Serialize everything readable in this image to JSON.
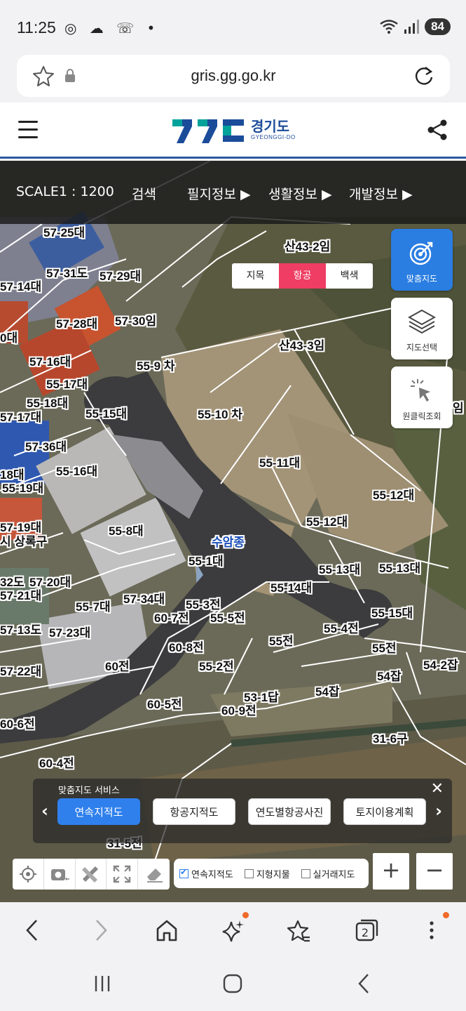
{
  "status": {
    "time": "11:25",
    "battery": "84",
    "notif_icons": "◎ ☁ ☏ •"
  },
  "browser": {
    "url": "gris.gg.go.kr"
  },
  "site": {
    "logo_text": "경기도",
    "logo_sub": "GYEONGGI-DO"
  },
  "topnav": {
    "scale": "SCALE1 : 1200",
    "search": "검색",
    "parcel": "필지정보 ▶",
    "life": "생활정보 ▶",
    "dev": "개발정보 ▶"
  },
  "map_mode": {
    "items": [
      "지목",
      "항공",
      "백색"
    ],
    "selected": "항공"
  },
  "side_buttons": {
    "custom": "맞춤지도",
    "select": "지도선택",
    "oneclick": "원클릭조회"
  },
  "service": {
    "title": "맞춤지도 서비스",
    "close": "✕",
    "chips": [
      "연속지적도",
      "항공지적도",
      "연도별항공사진",
      "토지이용계획"
    ],
    "active": "연속지적도"
  },
  "layers": {
    "items": [
      "연속지적도",
      "지형지물",
      "실거래지도"
    ],
    "checked": "연속지적도"
  },
  "zoom": {
    "plus": "+",
    "minus": "−"
  },
  "parcels": [
    "57-25대",
    "산43-2임",
    "57-31도",
    "57-29대",
    "57-14대",
    "57-28대",
    "57-30임",
    "0대",
    "산43-3임",
    "57-16대",
    "55-9 차",
    "55-17대",
    "55-18대",
    "55-15대",
    "57-17대",
    "55-10 차",
    "57-36대",
    "55-11대",
    "55-16대",
    "18대",
    "55-19대",
    "55-12대",
    "55-12대",
    "55-8대",
    "57-19대",
    "수암종",
    "시 상록구",
    "55-1대",
    "55-13대",
    "55-13대",
    "32도",
    "57-20대",
    "57-21대",
    "55-14대",
    "57-34대",
    "55-7대",
    "55-3전",
    "60-7전",
    "55-5전",
    "55-15대",
    "55-4전",
    "57-13도",
    "57-23대",
    "55전",
    "60-8전",
    "55전",
    "54-2잡",
    "57-22대",
    "60전",
    "55-2전",
    "54잡",
    "54잡",
    "53-1답",
    "60-5전",
    "60-9전",
    "60-6전",
    "31-6구",
    "60-4전",
    "31-5전",
    "임"
  ]
}
